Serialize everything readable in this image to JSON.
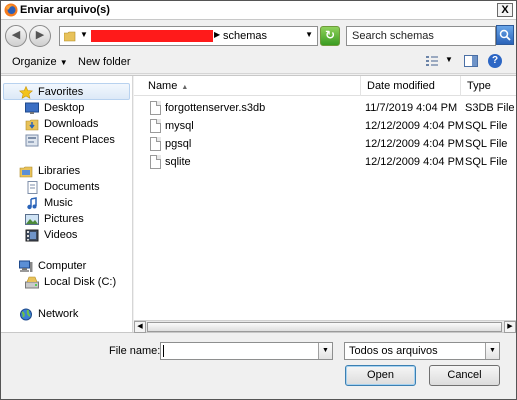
{
  "window": {
    "title": "Enviar arquivo(s)",
    "close_glyph": "X"
  },
  "address": {
    "path_current": "schemas",
    "search_placeholder": "Search schemas"
  },
  "toolbar": {
    "organize_label": "Organize",
    "organize_arrow": "▼",
    "new_folder_label": "New folder",
    "help_glyph": "?"
  },
  "sidebar": {
    "favorites": {
      "label": "Favorites",
      "items": [
        {
          "label": "Desktop",
          "icon": "desktop-icon"
        },
        {
          "label": "Downloads",
          "icon": "downloads-icon"
        },
        {
          "label": "Recent Places",
          "icon": "recent-places-icon"
        }
      ]
    },
    "libraries": {
      "label": "Libraries",
      "items": [
        {
          "label": "Documents",
          "icon": "documents-icon"
        },
        {
          "label": "Music",
          "icon": "music-icon"
        },
        {
          "label": "Pictures",
          "icon": "pictures-icon"
        },
        {
          "label": "Videos",
          "icon": "videos-icon"
        }
      ]
    },
    "computer": {
      "label": "Computer",
      "items": [
        {
          "label": "Local Disk (C:)",
          "icon": "local-disk-icon"
        }
      ]
    },
    "network": {
      "label": "Network"
    }
  },
  "file_list": {
    "columns": [
      "Name",
      "Date modified",
      "Type"
    ],
    "rows": [
      {
        "name": "forgottenserver.s3db",
        "date": "11/7/2019 4:04 PM",
        "type": "S3DB File"
      },
      {
        "name": "mysql",
        "date": "12/12/2009 4:04 PM",
        "type": "SQL File"
      },
      {
        "name": "pgsql",
        "date": "12/12/2009 4:04 PM",
        "type": "SQL File"
      },
      {
        "name": "sqlite",
        "date": "12/12/2009 4:04 PM",
        "type": "SQL File"
      }
    ]
  },
  "bottom": {
    "file_name_label": "File name:",
    "file_name_value": "",
    "file_type_selected": "Todos os arquivos",
    "open_label": "Open",
    "cancel_label": "Cancel"
  },
  "colors": {
    "redaction": "#ff1a1a",
    "accent": "#2c66c4"
  }
}
